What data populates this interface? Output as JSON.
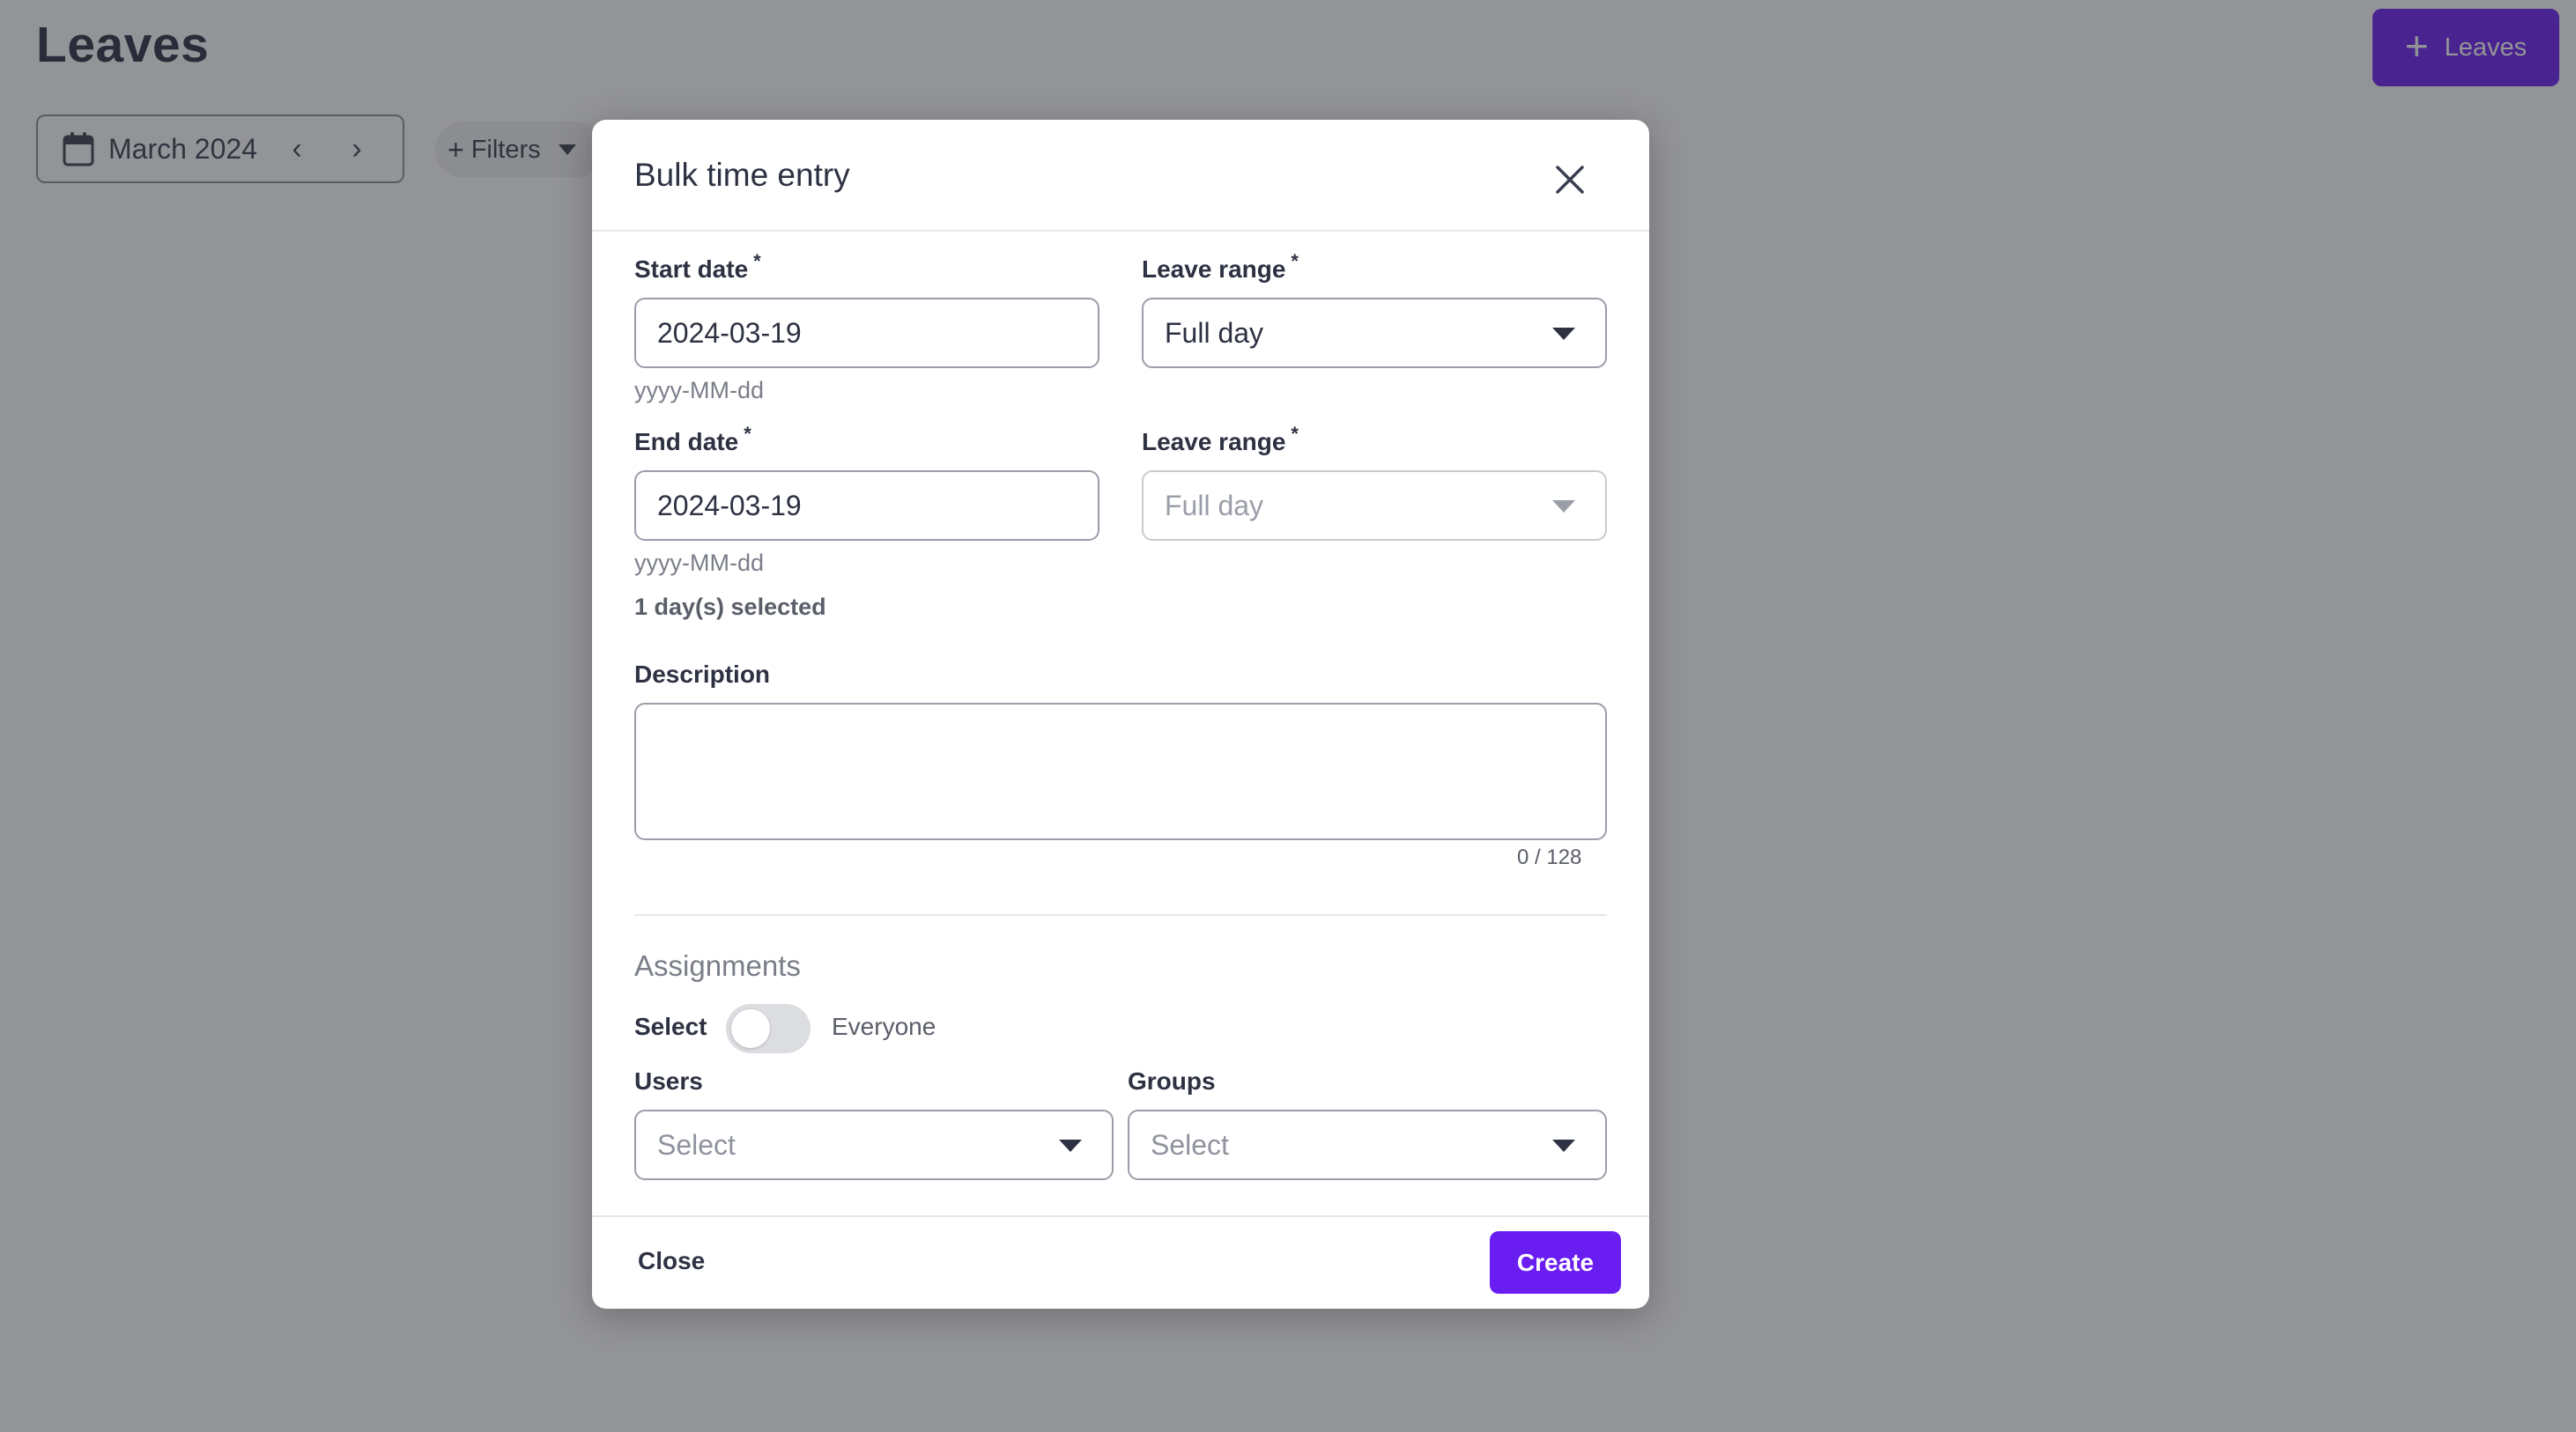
{
  "page": {
    "title": "Leaves",
    "add_button_label": "Leaves",
    "month_picker": {
      "label": "March 2024",
      "prev_icon": "chevron-left-icon",
      "next_icon": "chevron-right-icon"
    },
    "filters_label": "Filters"
  },
  "modal": {
    "title": "Bulk time entry",
    "start_date": {
      "label": "Start date",
      "required_mark": "*",
      "value": "2024-03-19",
      "hint": "yyyy-MM-dd"
    },
    "start_range": {
      "label": "Leave range",
      "required_mark": "*",
      "value": "Full day"
    },
    "end_date": {
      "label": "End date",
      "required_mark": "*",
      "value": "2024-03-19",
      "hint": "yyyy-MM-dd"
    },
    "end_range": {
      "label": "Leave range",
      "required_mark": "*",
      "value": "Full day",
      "disabled": true
    },
    "days_selected": "1 day(s) selected",
    "description": {
      "label": "Description",
      "value": "",
      "counter": "0 / 128"
    },
    "assignments": {
      "title": "Assignments",
      "toggle_left_label": "Select",
      "toggle_right_label": "Everyone",
      "toggle_on": false,
      "users": {
        "label": "Users",
        "placeholder": "Select"
      },
      "groups": {
        "label": "Groups",
        "placeholder": "Select"
      }
    },
    "footer": {
      "close_label": "Close",
      "create_label": "Create"
    }
  },
  "colors": {
    "accent": "#6a1df0",
    "overlay": "rgba(40,42,48,0.5)",
    "text": "#2d3142"
  }
}
